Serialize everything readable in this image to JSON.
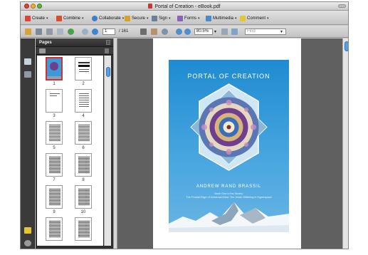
{
  "window": {
    "title": "Portal of Creation - eBook.pdf"
  },
  "tasks": {
    "create": "Create",
    "combine": "Combine",
    "collaborate": "Collaborate",
    "secure": "Secure",
    "sign": "Sign",
    "forms": "Forms",
    "multimedia": "Multimedia",
    "comment": "Comment",
    "dropdown_glyph": "▾"
  },
  "toolbar": {
    "page_number": "1",
    "page_total": "/ 161",
    "zoom": "80.5%",
    "find_placeholder": "Find"
  },
  "sidebar": {
    "panel_title": "Pages",
    "thumb_labels": [
      "1",
      "2",
      "3",
      "4",
      "5",
      "6",
      "7",
      "8",
      "9",
      "10"
    ]
  },
  "cover": {
    "title": "PORTAL OF CREATION",
    "author": "ANDREW RAND BRASSIL",
    "subtitle_line1": "Book One in the Series:",
    "subtitle_line2": "The Fractal Edge of Universal Mind: The Jewel Glittering in Hyperspace"
  },
  "colors": {
    "cover_blue": "#2f97d8",
    "accent_red": "#cc3333",
    "dark_panel": "#2e2e2e"
  }
}
